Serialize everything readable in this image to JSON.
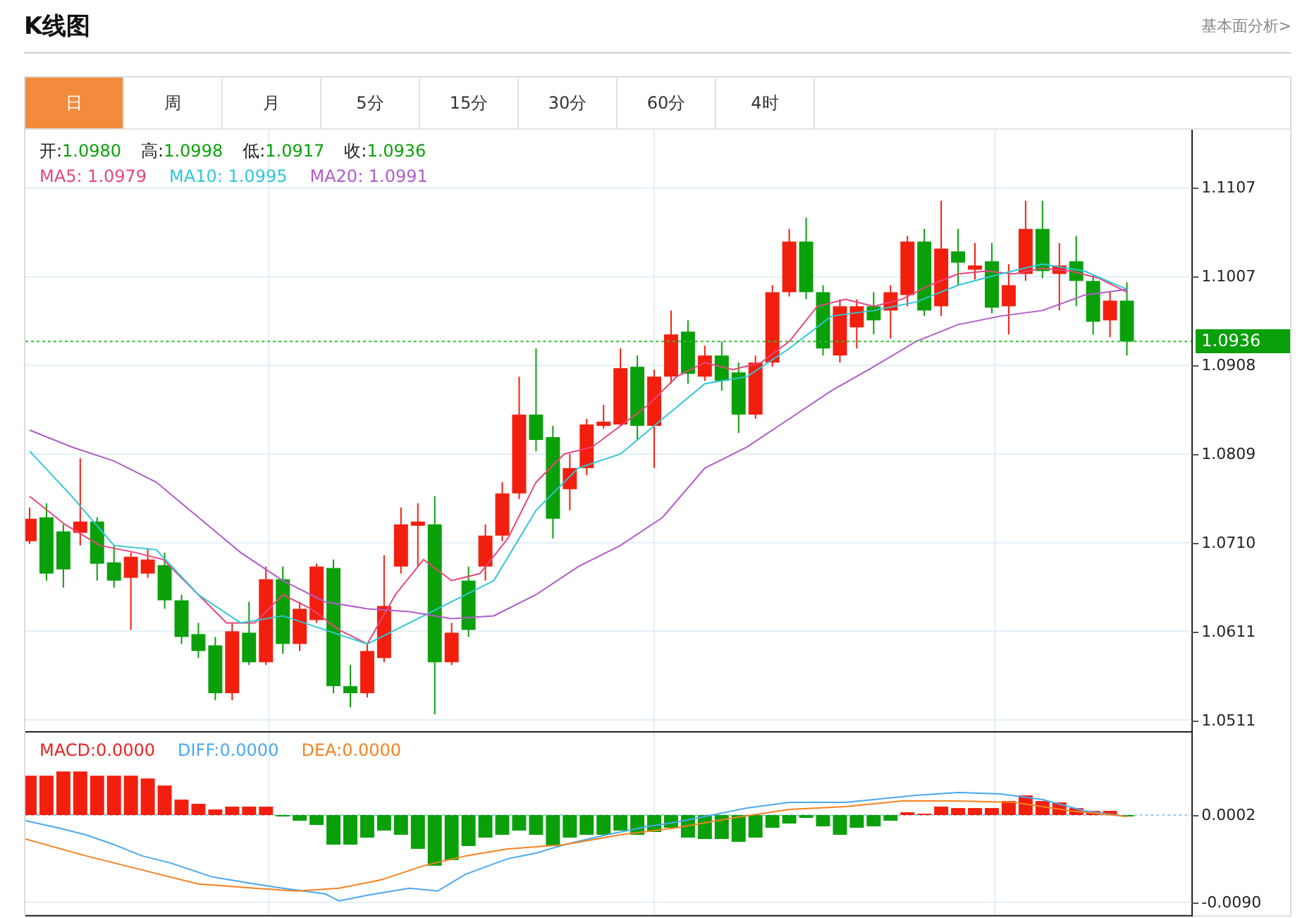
{
  "header": {
    "title": "K线图",
    "link": "基本面分析>"
  },
  "tabs": [
    {
      "label": "日",
      "selected": true
    },
    {
      "label": "周",
      "selected": false
    },
    {
      "label": "月",
      "selected": false
    },
    {
      "label": "5分",
      "selected": false
    },
    {
      "label": "15分",
      "selected": false
    },
    {
      "label": "30分",
      "selected": false
    },
    {
      "label": "60分",
      "selected": false
    },
    {
      "label": "4时",
      "selected": false
    }
  ],
  "quote": [
    {
      "label": "开:",
      "value": "1.0980"
    },
    {
      "label": "高:",
      "value": "1.0998"
    },
    {
      "label": "低:",
      "value": "1.0917"
    },
    {
      "label": "收:",
      "value": "1.0936"
    }
  ],
  "moving_averages": [
    {
      "label": "MA5: 1.0979",
      "color": "#e8467c"
    },
    {
      "label": "MA10: 1.0995",
      "color": "#2ec7d8"
    },
    {
      "label": "MA20: 1.0991",
      "color": "#b05cc8"
    }
  ],
  "price_axis": [
    "1.1107",
    "1.1007",
    "1.0908",
    "1.0809",
    "1.0710",
    "1.0611",
    "1.0511"
  ],
  "current_price": "1.0936",
  "macd_legend": [
    {
      "label": "MACD:0.0000",
      "color": "#ee2222"
    },
    {
      "label": "DIFF:0.0000",
      "color": "#4aa8f0"
    },
    {
      "label": "DEA:0.0000",
      "color": "#f58220"
    }
  ],
  "macd_axis": [
    "0.0002",
    "-0.0090"
  ]
}
